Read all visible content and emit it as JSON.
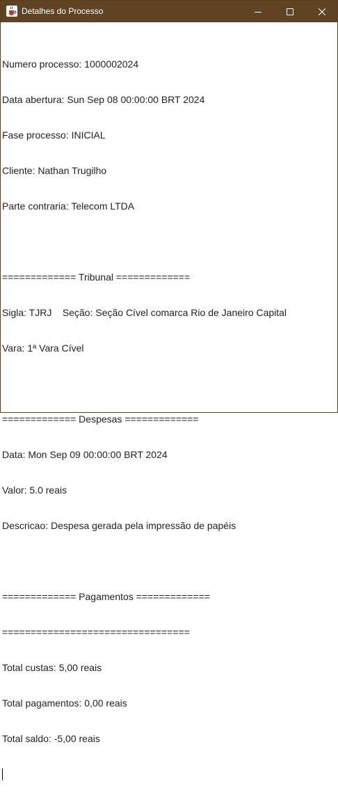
{
  "window": {
    "title": "Detalhes do Processo",
    "icon": "java-coffee-cup-icon",
    "controls": [
      "minimize-icon",
      "maximize-icon",
      "close-icon"
    ],
    "titlebar_color": "#5f4322"
  },
  "details": {
    "lines": [
      "Numero processo: 1000002024",
      "Data abertura: Sun Sep 08 00:00:00 BRT 2024",
      "Fase processo: INICIAL",
      "Cliente: Nathan Trugilho",
      "Parte contraria: Telecom LTDA",
      "",
      "============= Tribunal =============",
      "Sigla: TJRJ    Seção: Seção Cível comarca Rio de Janeiro Capital",
      "Vara: 1ª Vara Cível",
      "",
      "============= Despesas =============",
      "Data: Mon Sep 09 00:00:00 BRT 2024",
      "Valor: 5.0 reais",
      "Descricao: Despesa gerada pela impressão de papéis",
      "",
      "============= Pagamentos =============",
      "=================================",
      "Total custas: 5,00 reais",
      "Total pagamentos: 0,00 reais",
      "Total saldo: -5,00 reais"
    ]
  }
}
